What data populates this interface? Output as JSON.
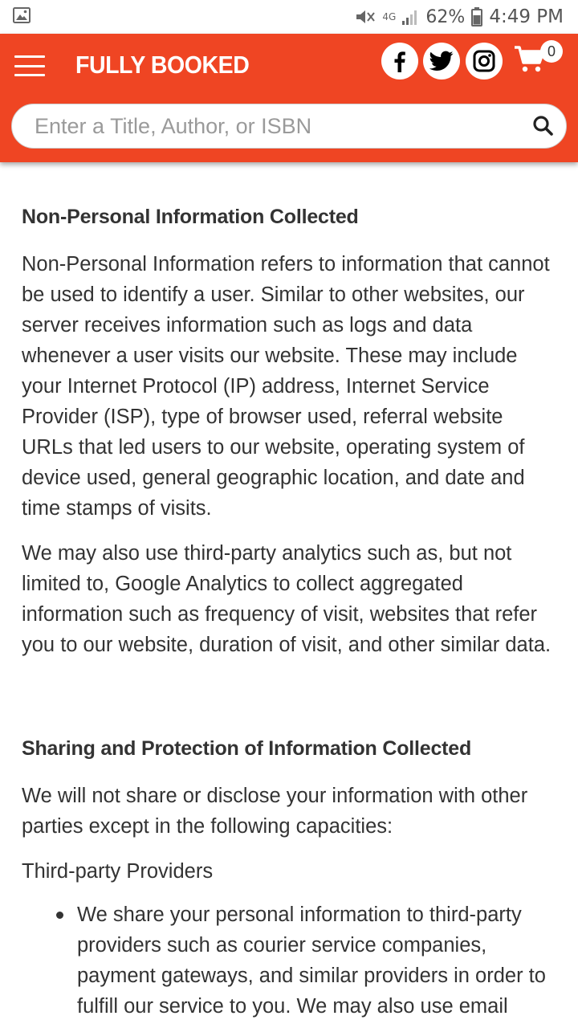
{
  "status_bar": {
    "battery_pct": "62%",
    "time": "4:49 PM",
    "network": "4G"
  },
  "header": {
    "brand": "FULLY BOOKED",
    "brand_color": "#ef4523",
    "cart_count": "0",
    "icons": [
      "menu-icon",
      "facebook-icon",
      "twitter-icon",
      "instagram-icon",
      "cart-icon",
      "search-icon"
    ]
  },
  "search": {
    "placeholder": "Enter a Title, Author, or ISBN",
    "value": ""
  },
  "content": {
    "section1": {
      "heading": "Non-Personal Information Collected",
      "p1": "Non-Personal Information refers to information that cannot be used to identify a user. Similar to other websites, our server receives information such as logs and data whenever a user visits our website. These may include your Internet Protocol (IP) address, Internet Service Provider (ISP), type of browser used, referral website URLs that led users to our website, operating system of device used, general geographic location, and date and time stamps of visits.",
      "p2": "We may also use third-party analytics such as, but not limited to, Google Analytics to collect aggregated information such as frequency of visit, websites that refer you to our website, duration of visit, and other similar data."
    },
    "section2": {
      "heading": "Sharing and Protection of Information Collected",
      "p1": "We will not share or disclose your information with other parties except in the following capacities:",
      "subheading": "Third-party Providers",
      "bullets": [
        "We share your personal information to third-party providers such as courier service companies, payment gateways, and similar providers in order to fulfill our service to you. We may also use email"
      ]
    }
  }
}
